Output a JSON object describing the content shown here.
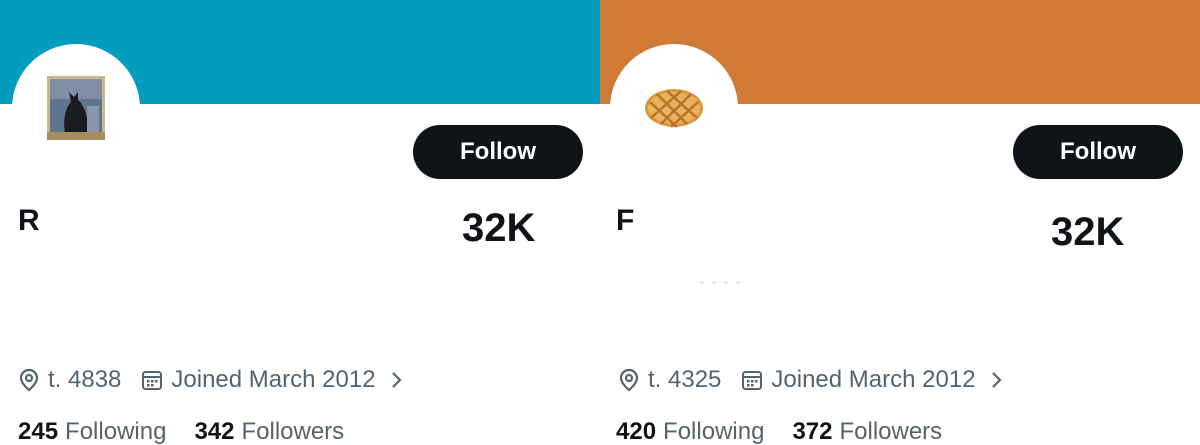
{
  "cards": [
    {
      "banner_color": "#029cbf",
      "avatar_icon": "cat-painting-image",
      "follow_label": "Follow",
      "display_name": "R",
      "big_count": "32K",
      "location": "t. 4838",
      "joined": "Joined March 2012",
      "following_count": "245",
      "following_label": "Following",
      "followers_count": "342",
      "followers_label": "Followers"
    },
    {
      "banner_color": "#d07a36",
      "avatar_icon": "waffle-image",
      "follow_label": "Follow",
      "display_name": "F",
      "big_count": "32K",
      "location": "t. 4325",
      "joined": "Joined March 2012",
      "following_count": "420",
      "following_label": "Following",
      "followers_count": "372",
      "followers_label": "Followers"
    }
  ],
  "colors": {
    "text_primary": "#0f1419",
    "text_secondary": "#536471",
    "button_bg": "#0f1419"
  },
  "icons": [
    "location-pin-icon",
    "calendar-icon",
    "chevron-right-icon"
  ]
}
